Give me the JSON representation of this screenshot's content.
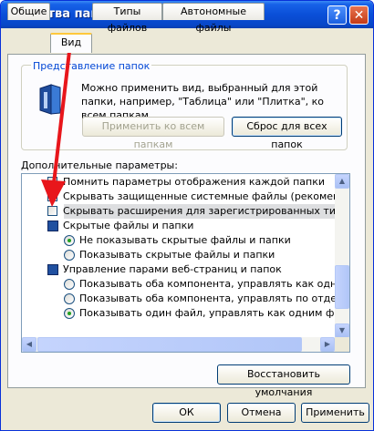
{
  "window": {
    "title": "Свойства папки",
    "help_label": "?",
    "close_label": "✕"
  },
  "tabs": [
    {
      "label": "Общие"
    },
    {
      "label": "Вид"
    },
    {
      "label": "Типы файлов"
    },
    {
      "label": "Автономные файлы"
    }
  ],
  "folder_views": {
    "group_title": "Представление папок",
    "description": "Можно применить вид, выбранный для этой папки, например, \"Таблица\" или \"Плитка\", ко всем папкам.",
    "apply_all_label": "Применить ко всем папкам",
    "reset_all_label": "Сброс для всех папок"
  },
  "advanced": {
    "label": "Дополнительные параметры:",
    "items": [
      {
        "text": "Помнить параметры отображения каждой папки",
        "type": "checkbox",
        "checked": false
      },
      {
        "text": "Скрывать защищенные системные файлы (рекомендуется)",
        "type": "checkbox",
        "checked": true
      },
      {
        "text": "Скрывать расширения для зарегистрированных типов файлов",
        "type": "checkbox",
        "checked": false
      },
      {
        "text": "Скрытые файлы и папки",
        "type": "folder"
      },
      {
        "text": "Не показывать скрытые файлы и папки",
        "type": "radio",
        "checked": true
      },
      {
        "text": "Показывать скрытые файлы и папки",
        "type": "radio",
        "checked": false
      },
      {
        "text": "Управление парами веб-страниц и папок",
        "type": "folder"
      },
      {
        "text": "Показывать оба компонента, управлять как одним файлом",
        "type": "radio",
        "checked": false
      },
      {
        "text": "Показывать оба компонента, управлять по отдельности",
        "type": "radio",
        "checked": false
      },
      {
        "text": "Показывать один файл, управлять как одним файлом",
        "type": "radio",
        "checked": true
      }
    ],
    "restore_label": "Восстановить умолчания"
  },
  "footer": {
    "ok_label": "ОК",
    "cancel_label": "Отмена",
    "apply_label": "Применить"
  },
  "annotation": {
    "arrow_color": "#e8161b"
  }
}
